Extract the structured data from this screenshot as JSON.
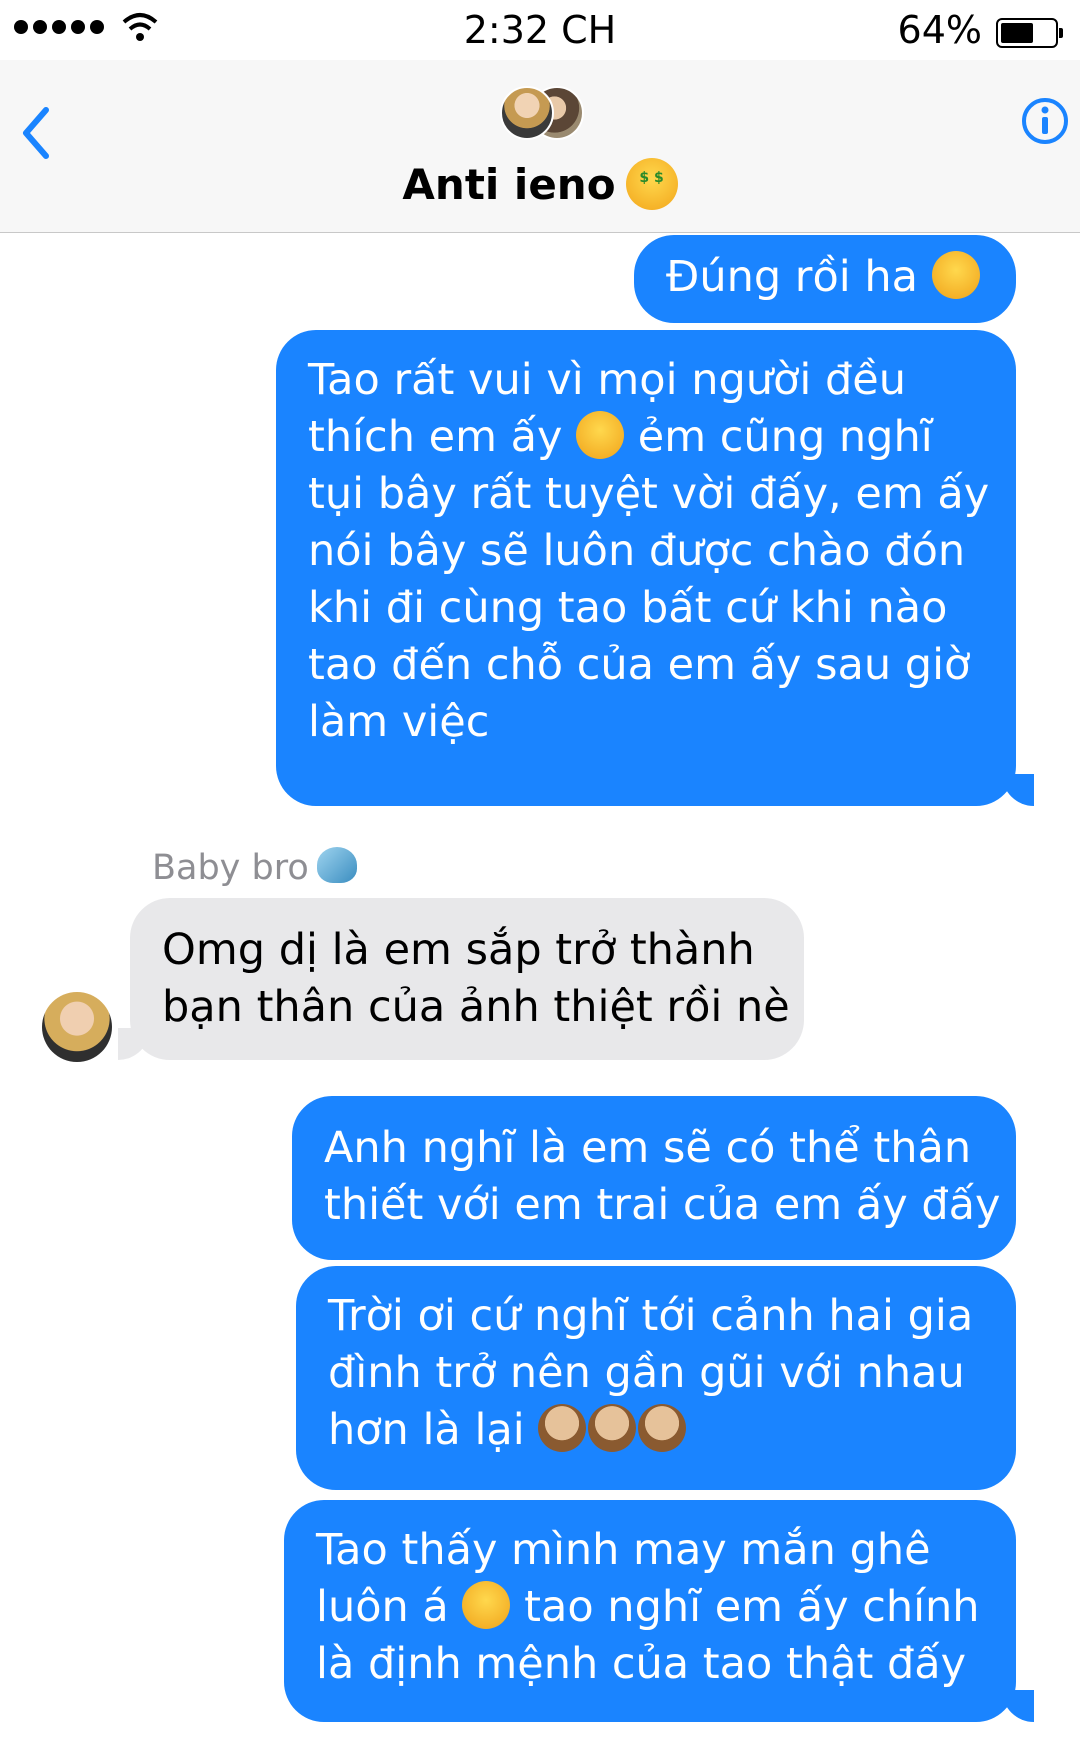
{
  "status_bar": {
    "time": "2:32 CH",
    "battery_percent": "64%",
    "battery_level": 0.64
  },
  "header": {
    "back_icon": "chevron-left-icon",
    "info_icon": "info-icon",
    "title": "Anti ieno",
    "title_emoji": "money-mouth-face-emoji"
  },
  "messages": [
    {
      "direction": "outgoing",
      "lines": [
        "Đúng rồi ha"
      ],
      "trailing_emoji": "grinning-sweat-emoji"
    },
    {
      "direction": "outgoing",
      "lines": [
        "Tao rất vui vì mọi người đều",
        "thích em ấy",
        "ẻm cũng nghĩ",
        "tụi bây rất tuyệt vời đấy, em ấy",
        "nói bây sẽ luôn được chào đón",
        "khi đi cùng tao bất cứ khi nào",
        "tao đến chỗ của em ấy sau giờ",
        "làm việc"
      ]
    },
    {
      "direction": "incoming",
      "sender": "Baby bro",
      "sender_emoji": "dolphin-emoji",
      "lines": [
        "Omg dị là em sắp trở thành",
        "bạn thân của ảnh thiệt rồi nè"
      ]
    },
    {
      "direction": "outgoing",
      "lines": [
        "Anh nghĩ là em sẽ có thể thân",
        "thiết với em trai của em ấy đấy"
      ]
    },
    {
      "direction": "outgoing",
      "lines": [
        "Trời ơi cứ nghĩ tới cảnh hai gia",
        "đình trở nên gần gũi với nhau",
        "hơn là lại"
      ],
      "trailing_emoji": "see-no-evil-monkey-emoji x3"
    },
    {
      "direction": "outgoing",
      "lines": [
        "Tao thấy mình may mắn ghê",
        "luôn á",
        "tao nghĩ em ấy chính",
        "là định mệnh của tao thật đấy"
      ]
    }
  ],
  "colors": {
    "outgoing_bubble": "#1a84ff",
    "incoming_bubble": "#e8e8ea",
    "header_bg": "#f7f7f7",
    "accent": "#1a84ff"
  }
}
